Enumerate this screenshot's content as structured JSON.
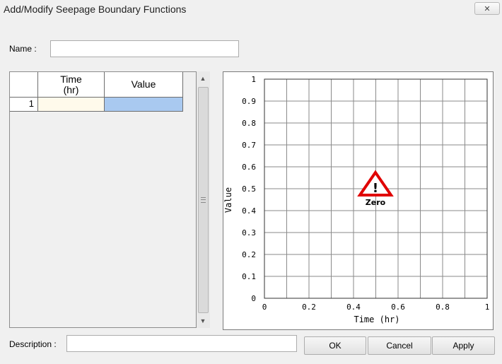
{
  "window": {
    "title": "Add/Modify Seepage Boundary Functions",
    "close_symbol": "✕"
  },
  "name_field": {
    "label": "Name :",
    "value": ""
  },
  "grid": {
    "columns": [
      "Time\n(hr)",
      "Value"
    ],
    "rows": [
      {
        "index": "1",
        "time": "",
        "value": ""
      }
    ]
  },
  "chart_data": {
    "type": "line",
    "xlabel": "Time (hr)",
    "ylabel": "Value",
    "xlim": [
      0,
      1
    ],
    "ylim": [
      0,
      1
    ],
    "x_ticks": [
      "0",
      "0.2",
      "0.4",
      "0.6",
      "0.8",
      "1"
    ],
    "y_ticks": [
      "0",
      "0.1",
      "0.2",
      "0.3",
      "0.4",
      "0.5",
      "0.6",
      "0.7",
      "0.8",
      "0.9",
      "1"
    ],
    "grid": true,
    "series": [],
    "warning_text": "Zero",
    "warning_color": "#e00000"
  },
  "description_field": {
    "label": "Description :",
    "value": ""
  },
  "buttons": {
    "ok": "OK",
    "cancel": "Cancel",
    "apply": "Apply"
  }
}
